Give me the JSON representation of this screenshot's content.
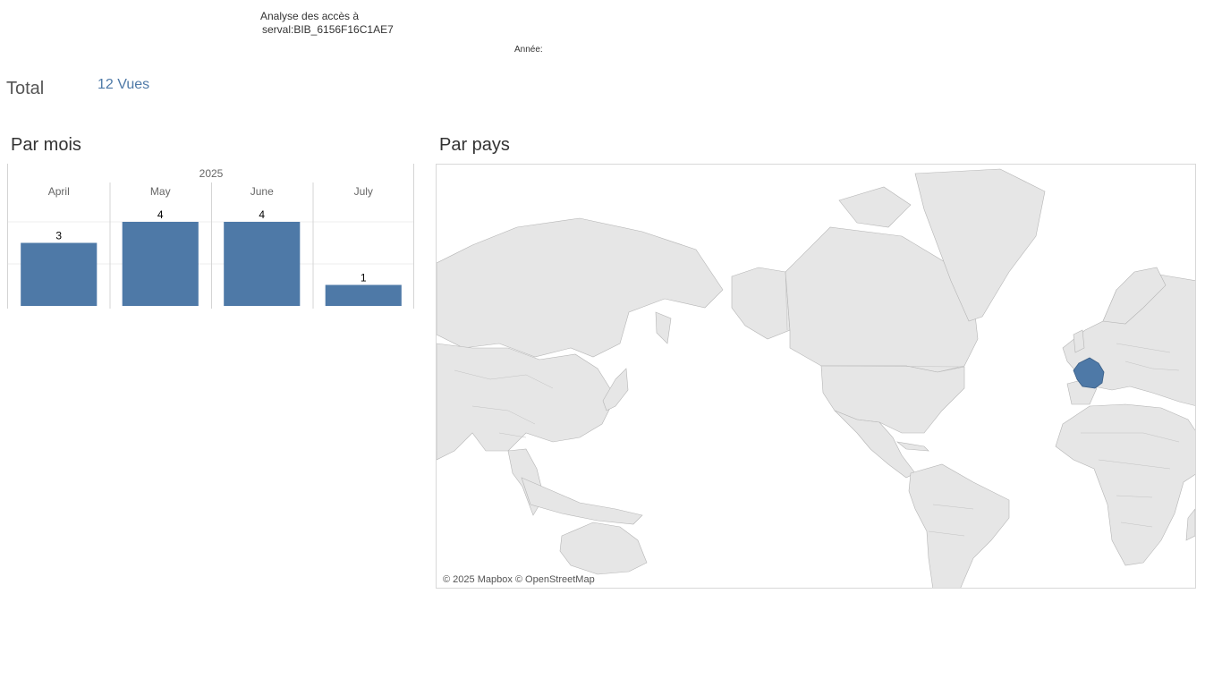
{
  "header": {
    "title_line1": "Analyse des accès à",
    "title_line2": "serval:BIB_6156F16C1AE7",
    "year_filter_label": "Année:"
  },
  "summary": {
    "total_label": "Total",
    "total_value": "12 Vues"
  },
  "sections": {
    "monthly_title": "Par mois",
    "country_title": "Par pays"
  },
  "map": {
    "attribution": "© 2025 Mapbox © OpenStreetMap",
    "highlighted_country": "France",
    "highlight_color": "#4e79a7",
    "land_color": "#e6e6e6",
    "border_color": "#b5b5b5"
  },
  "chart_data": {
    "type": "bar",
    "year_header": "2025",
    "categories": [
      "April",
      "May",
      "June",
      "July"
    ],
    "values": [
      3,
      4,
      4,
      1
    ],
    "value_labels": [
      "3",
      "4",
      "4",
      "1"
    ],
    "ylim": [
      0,
      4
    ],
    "grid": true,
    "bar_color": "#4e79a7"
  }
}
